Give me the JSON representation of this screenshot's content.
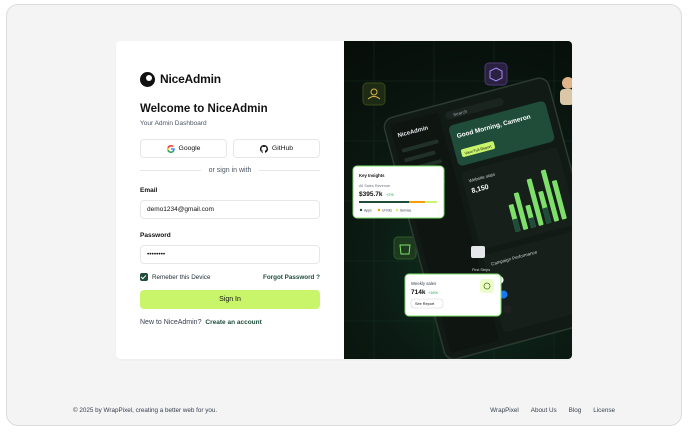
{
  "brand": {
    "name": "NiceAdmin"
  },
  "form": {
    "title": "Welcome to NiceAdmin",
    "subtitle": "Your Admin Dashboard",
    "google_label": "Google",
    "github_label": "GitHub",
    "divider_text": "or sign in with",
    "email_label": "Email",
    "email_value": "demo1234@gmail.com",
    "password_label": "Password",
    "password_value": "••••••••",
    "remember_label": "Remeber this Device",
    "remember_checked": true,
    "forgot_label": "Forgot Password ?",
    "signin_label": "Sign In",
    "signup_prompt": "New to NiceAdmin?",
    "signup_link": "Create an account"
  },
  "hero": {
    "dashboard_brand": "NiceAdmin",
    "greeting": "Good Morning, Cameron",
    "greeting_button": "View Full Report",
    "search_placeholder": "Search",
    "key_insights_title": "Key Insights",
    "sales_revenue_label": "All Sales Revenue",
    "sales_revenue_value": "$395.7k",
    "sales_revenue_change": "+2%",
    "legend": [
      "Apps",
      "UI Kits",
      "Service"
    ],
    "website_stats_label": "Website stats",
    "website_stats_value": "8,150",
    "weekly_sales_label": "Weekly sales",
    "weekly_sales_value": "714k",
    "weekly_sales_change": "+16%",
    "see_report_label": "See Report",
    "campaign_label": "Campaign Performance",
    "first_strip": "First Strips"
  },
  "footer": {
    "copyright": "© 2025 by WrapPixel, creating a better web for you.",
    "links": [
      "WrapPixel",
      "About Us",
      "Blog",
      "License"
    ]
  },
  "colors": {
    "accent": "#c9f56b",
    "brand_dark": "#1f4d3a",
    "hero_bg": "#0b1a12"
  }
}
